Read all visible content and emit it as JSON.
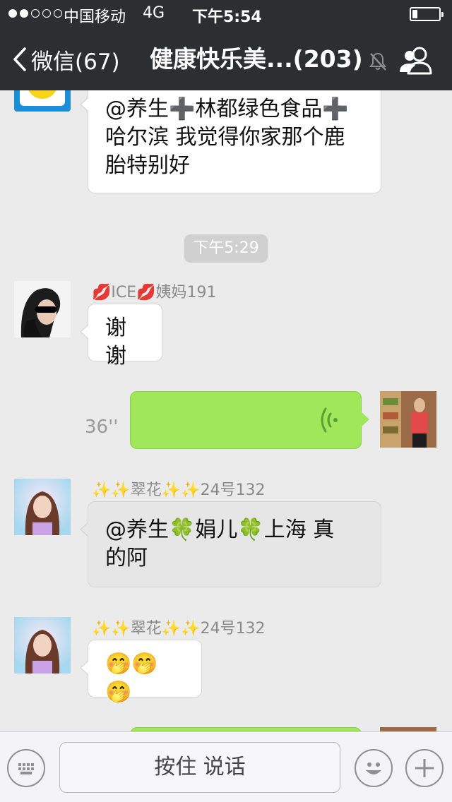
{
  "status_bar": {
    "carrier": "中国移动",
    "network": "4G",
    "time": "下午5:54",
    "signal_bars": 2,
    "signal_total": 5,
    "battery_level": 0.2
  },
  "nav": {
    "back_label": "微信(67)",
    "title": "健康快乐美...(203)",
    "mute_icon": "bell-muted-icon",
    "members_icon": "group-members-icon"
  },
  "messages": [
    {
      "sender": "",
      "text_lines": [
        "@养生➕林都绿色食品➕",
        "哈尔滨 我觉得你家那个鹿",
        "胎特别好"
      ]
    },
    {
      "time": "下午5:29"
    },
    {
      "sender": "💋ICE💋姨妈191",
      "text": "谢谢"
    },
    {
      "outgoing": true,
      "type": "voice",
      "duration": "36''"
    },
    {
      "sender": "✨✨翠花✨✨24号132",
      "text_lines": [
        "@养生🍀娟儿🍀上海 真",
        "的阿"
      ]
    },
    {
      "sender": "✨✨翠花✨✨24号132",
      "text": "🤭🤭🤭"
    }
  ],
  "input_bar": {
    "hold_to_talk": "按住 说话",
    "keyboard_icon": "keyboard-icon",
    "emoji_icon": "emoji-icon",
    "plus_icon": "plus-icon"
  },
  "colors": {
    "nav_bg": "#2d2e32",
    "chat_bg": "#ebebeb",
    "voice_bubble": "#a0e75a",
    "time_pill": "#d0d0d0"
  }
}
